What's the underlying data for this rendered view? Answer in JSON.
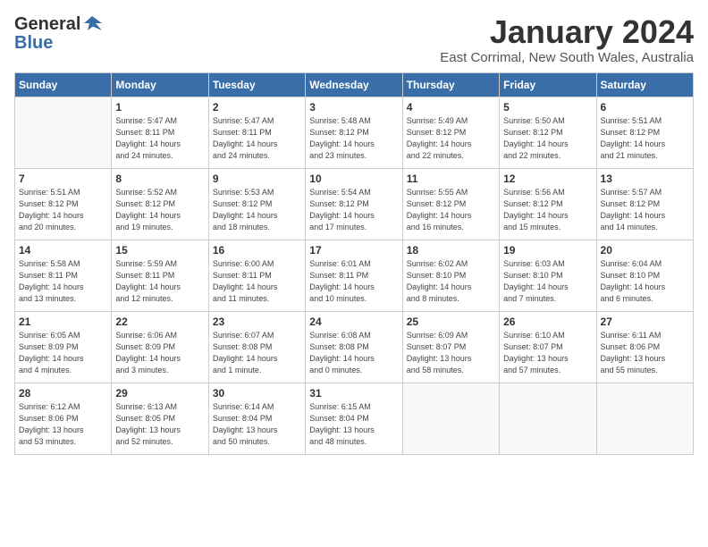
{
  "header": {
    "logo_general": "General",
    "logo_blue": "Blue",
    "month_title": "January 2024",
    "location": "East Corrimal, New South Wales, Australia"
  },
  "days_of_week": [
    "Sunday",
    "Monday",
    "Tuesday",
    "Wednesday",
    "Thursday",
    "Friday",
    "Saturday"
  ],
  "weeks": [
    [
      {
        "day": "",
        "info": ""
      },
      {
        "day": "1",
        "info": "Sunrise: 5:47 AM\nSunset: 8:11 PM\nDaylight: 14 hours\nand 24 minutes."
      },
      {
        "day": "2",
        "info": "Sunrise: 5:47 AM\nSunset: 8:11 PM\nDaylight: 14 hours\nand 24 minutes."
      },
      {
        "day": "3",
        "info": "Sunrise: 5:48 AM\nSunset: 8:12 PM\nDaylight: 14 hours\nand 23 minutes."
      },
      {
        "day": "4",
        "info": "Sunrise: 5:49 AM\nSunset: 8:12 PM\nDaylight: 14 hours\nand 22 minutes."
      },
      {
        "day": "5",
        "info": "Sunrise: 5:50 AM\nSunset: 8:12 PM\nDaylight: 14 hours\nand 22 minutes."
      },
      {
        "day": "6",
        "info": "Sunrise: 5:51 AM\nSunset: 8:12 PM\nDaylight: 14 hours\nand 21 minutes."
      }
    ],
    [
      {
        "day": "7",
        "info": "Sunrise: 5:51 AM\nSunset: 8:12 PM\nDaylight: 14 hours\nand 20 minutes."
      },
      {
        "day": "8",
        "info": "Sunrise: 5:52 AM\nSunset: 8:12 PM\nDaylight: 14 hours\nand 19 minutes."
      },
      {
        "day": "9",
        "info": "Sunrise: 5:53 AM\nSunset: 8:12 PM\nDaylight: 14 hours\nand 18 minutes."
      },
      {
        "day": "10",
        "info": "Sunrise: 5:54 AM\nSunset: 8:12 PM\nDaylight: 14 hours\nand 17 minutes."
      },
      {
        "day": "11",
        "info": "Sunrise: 5:55 AM\nSunset: 8:12 PM\nDaylight: 14 hours\nand 16 minutes."
      },
      {
        "day": "12",
        "info": "Sunrise: 5:56 AM\nSunset: 8:12 PM\nDaylight: 14 hours\nand 15 minutes."
      },
      {
        "day": "13",
        "info": "Sunrise: 5:57 AM\nSunset: 8:12 PM\nDaylight: 14 hours\nand 14 minutes."
      }
    ],
    [
      {
        "day": "14",
        "info": "Sunrise: 5:58 AM\nSunset: 8:11 PM\nDaylight: 14 hours\nand 13 minutes."
      },
      {
        "day": "15",
        "info": "Sunrise: 5:59 AM\nSunset: 8:11 PM\nDaylight: 14 hours\nand 12 minutes."
      },
      {
        "day": "16",
        "info": "Sunrise: 6:00 AM\nSunset: 8:11 PM\nDaylight: 14 hours\nand 11 minutes."
      },
      {
        "day": "17",
        "info": "Sunrise: 6:01 AM\nSunset: 8:11 PM\nDaylight: 14 hours\nand 10 minutes."
      },
      {
        "day": "18",
        "info": "Sunrise: 6:02 AM\nSunset: 8:10 PM\nDaylight: 14 hours\nand 8 minutes."
      },
      {
        "day": "19",
        "info": "Sunrise: 6:03 AM\nSunset: 8:10 PM\nDaylight: 14 hours\nand 7 minutes."
      },
      {
        "day": "20",
        "info": "Sunrise: 6:04 AM\nSunset: 8:10 PM\nDaylight: 14 hours\nand 6 minutes."
      }
    ],
    [
      {
        "day": "21",
        "info": "Sunrise: 6:05 AM\nSunset: 8:09 PM\nDaylight: 14 hours\nand 4 minutes."
      },
      {
        "day": "22",
        "info": "Sunrise: 6:06 AM\nSunset: 8:09 PM\nDaylight: 14 hours\nand 3 minutes."
      },
      {
        "day": "23",
        "info": "Sunrise: 6:07 AM\nSunset: 8:08 PM\nDaylight: 14 hours\nand 1 minute."
      },
      {
        "day": "24",
        "info": "Sunrise: 6:08 AM\nSunset: 8:08 PM\nDaylight: 14 hours\nand 0 minutes."
      },
      {
        "day": "25",
        "info": "Sunrise: 6:09 AM\nSunset: 8:07 PM\nDaylight: 13 hours\nand 58 minutes."
      },
      {
        "day": "26",
        "info": "Sunrise: 6:10 AM\nSunset: 8:07 PM\nDaylight: 13 hours\nand 57 minutes."
      },
      {
        "day": "27",
        "info": "Sunrise: 6:11 AM\nSunset: 8:06 PM\nDaylight: 13 hours\nand 55 minutes."
      }
    ],
    [
      {
        "day": "28",
        "info": "Sunrise: 6:12 AM\nSunset: 8:06 PM\nDaylight: 13 hours\nand 53 minutes."
      },
      {
        "day": "29",
        "info": "Sunrise: 6:13 AM\nSunset: 8:05 PM\nDaylight: 13 hours\nand 52 minutes."
      },
      {
        "day": "30",
        "info": "Sunrise: 6:14 AM\nSunset: 8:04 PM\nDaylight: 13 hours\nand 50 minutes."
      },
      {
        "day": "31",
        "info": "Sunrise: 6:15 AM\nSunset: 8:04 PM\nDaylight: 13 hours\nand 48 minutes."
      },
      {
        "day": "",
        "info": ""
      },
      {
        "day": "",
        "info": ""
      },
      {
        "day": "",
        "info": ""
      }
    ]
  ]
}
